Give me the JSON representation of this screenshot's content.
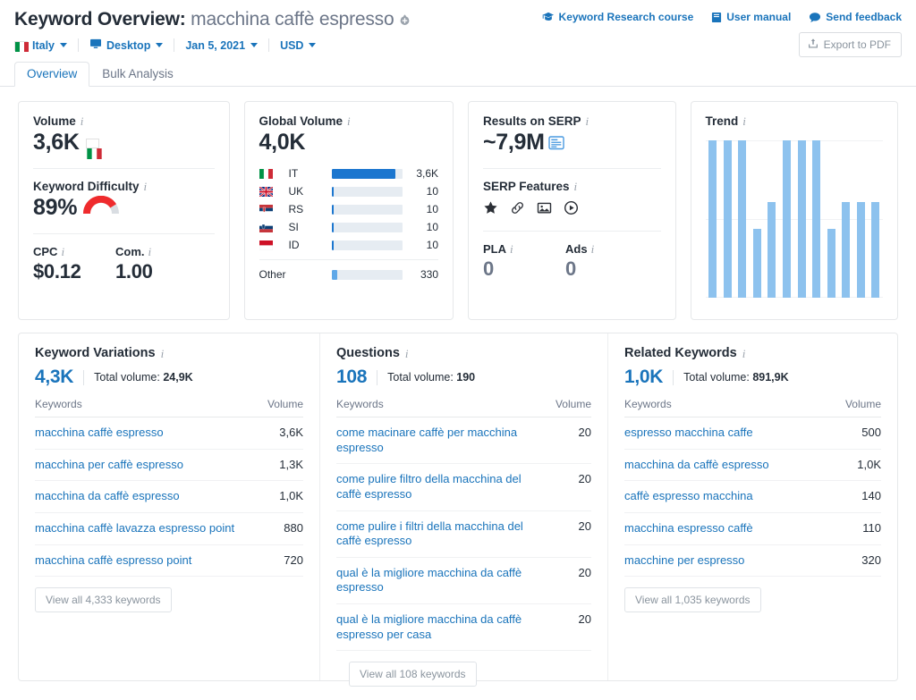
{
  "header": {
    "title_prefix": "Keyword Overview:",
    "keyword": "macchina caffè espresso",
    "add_icon": "add-keyword-icon",
    "links": [
      {
        "label": "Keyword Research course",
        "icon": "graduation-cap-icon"
      },
      {
        "label": "User manual",
        "icon": "book-icon"
      },
      {
        "label": "Send feedback",
        "icon": "speech-bubble-icon"
      }
    ],
    "export_button": {
      "label": "Export to PDF",
      "icon": "export-icon"
    },
    "filters": [
      {
        "name": "country",
        "label": "Italy",
        "icon": "flag-it-icon"
      },
      {
        "name": "device",
        "label": "Desktop",
        "icon": "monitor-icon"
      },
      {
        "name": "date",
        "label": "Jan 5, 2021",
        "icon": null
      },
      {
        "name": "currency",
        "label": "USD",
        "icon": null
      }
    ]
  },
  "tabs": [
    {
      "label": "Overview",
      "active": true
    },
    {
      "label": "Bulk Analysis",
      "active": false
    }
  ],
  "volume_card": {
    "label": "Volume",
    "value": "3,6K",
    "flag": "flag-it-icon",
    "difficulty_label": "Keyword Difficulty",
    "difficulty_value": "89%",
    "difficulty_percent": 89,
    "difficulty_color": "#ef2b2d",
    "cpc_label": "CPC",
    "cpc_value": "$0.12",
    "com_label": "Com.",
    "com_value": "1.00"
  },
  "global_volume_card": {
    "label": "Global Volume",
    "value": "4,0K",
    "rows": [
      {
        "code": "IT",
        "flag": "flag-it-icon",
        "value": "3,6K",
        "pct": 90,
        "accent": "dark"
      },
      {
        "code": "UK",
        "flag": "flag-uk-icon",
        "value": "10",
        "pct": 3,
        "accent": "dark"
      },
      {
        "code": "RS",
        "flag": "flag-rs-icon",
        "value": "10",
        "pct": 3,
        "accent": "dark"
      },
      {
        "code": "SI",
        "flag": "flag-si-icon",
        "value": "10",
        "pct": 3,
        "accent": "dark"
      },
      {
        "code": "ID",
        "flag": "flag-id-icon",
        "value": "10",
        "pct": 3,
        "accent": "dark"
      }
    ],
    "other": {
      "code": "Other",
      "value": "330",
      "pct": 8,
      "accent": "light"
    }
  },
  "serp_card": {
    "label": "Results on SERP",
    "value": "~7,9M",
    "results_icon": "serp-snippet-icon",
    "features_label": "SERP Features",
    "features": [
      {
        "name": "reviews-star-icon",
        "glyph": "★"
      },
      {
        "name": "sitelinks-icon",
        "glyph": "link"
      },
      {
        "name": "image-pack-icon",
        "glyph": "image"
      },
      {
        "name": "video-icon",
        "glyph": "play"
      }
    ],
    "pla_label": "PLA",
    "pla_value": "0",
    "ads_label": "Ads",
    "ads_value": "0"
  },
  "trend_card": {
    "label": "Trend"
  },
  "chart_data": {
    "type": "bar",
    "title": "Trend",
    "categories": [
      "1",
      "2",
      "3",
      "4",
      "5",
      "6",
      "7",
      "8",
      "9",
      "10",
      "11",
      "12"
    ],
    "values": [
      100,
      100,
      100,
      44,
      61,
      100,
      100,
      100,
      44,
      61,
      61,
      61
    ],
    "ylim": [
      0,
      100
    ],
    "grid": true,
    "bar_color": "#8dc2ee",
    "xlabel": "",
    "ylabel": ""
  },
  "keyword_variations": {
    "title": "Keyword Variations",
    "count": "4,3K",
    "total_label": "Total volume:",
    "total_value": "24,9K",
    "columns": [
      "Keywords",
      "Volume"
    ],
    "rows": [
      {
        "keyword": "macchina caffè espresso",
        "volume": "3,6K"
      },
      {
        "keyword": "macchina per caffè espresso",
        "volume": "1,3K"
      },
      {
        "keyword": "macchina da caffè espresso",
        "volume": "1,0K"
      },
      {
        "keyword": "macchina caffè lavazza espresso point",
        "volume": "880"
      },
      {
        "keyword": "macchina caffè espresso point",
        "volume": "720"
      }
    ],
    "view_all": "View all 4,333 keywords"
  },
  "questions": {
    "title": "Questions",
    "count": "108",
    "total_label": "Total volume:",
    "total_value": "190",
    "columns": [
      "Keywords",
      "Volume"
    ],
    "rows": [
      {
        "keyword": "come macinare caffè per macchina espresso",
        "volume": "20"
      },
      {
        "keyword": "come pulire filtro della macchina del caffè espresso",
        "volume": "20"
      },
      {
        "keyword": "come pulire i filtri della macchina del caffè espresso",
        "volume": "20"
      },
      {
        "keyword": "qual è la migliore macchina da caffè espresso",
        "volume": "20"
      },
      {
        "keyword": "qual è la migliore macchina da caffè espresso per casa",
        "volume": "20"
      }
    ],
    "view_all": "View all 108 keywords"
  },
  "related_keywords": {
    "title": "Related Keywords",
    "count": "1,0K",
    "total_label": "Total volume:",
    "total_value": "891,9K",
    "columns": [
      "Keywords",
      "Volume"
    ],
    "rows": [
      {
        "keyword": "espresso macchina caffe",
        "volume": "500"
      },
      {
        "keyword": "macchina da caffè espresso",
        "volume": "1,0K"
      },
      {
        "keyword": "caffè espresso macchina",
        "volume": "140"
      },
      {
        "keyword": "macchina espresso caffè",
        "volume": "110"
      },
      {
        "keyword": "macchine per espresso",
        "volume": "320"
      }
    ],
    "view_all": "View all 1,035 keywords"
  },
  "colors": {
    "link": "#1a74bb",
    "accent_bar": "#1b76cf",
    "trend_bar": "#8dc2ee",
    "danger": "#ef2b2d",
    "text": "#242d38",
    "muted": "#6c7688"
  }
}
